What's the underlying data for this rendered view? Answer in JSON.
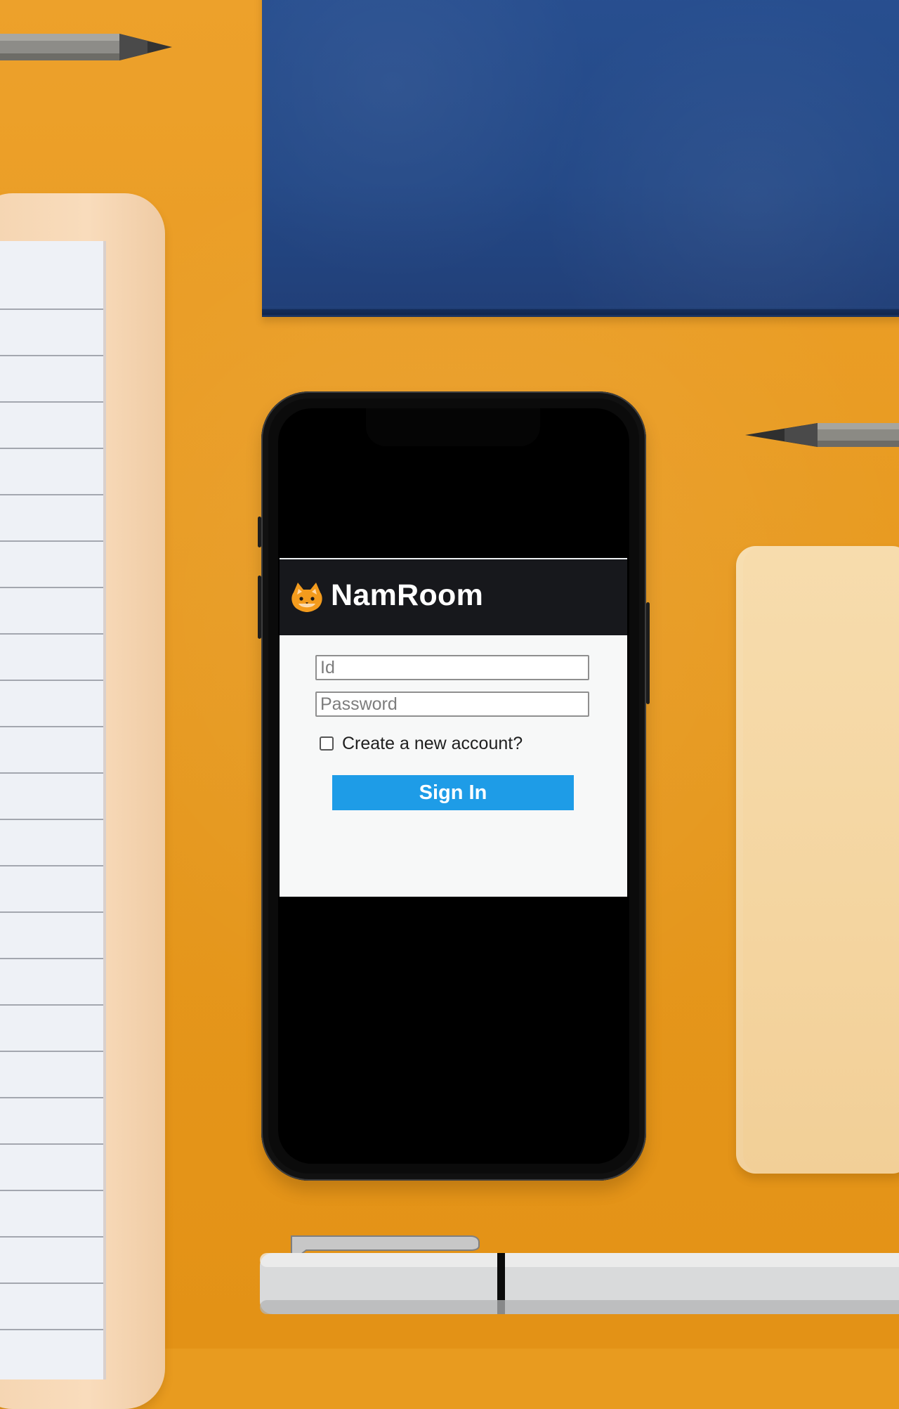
{
  "app": {
    "title": "NamRoom"
  },
  "login_form": {
    "id_placeholder": "Id",
    "password_placeholder": "Password",
    "create_account_label": "Create a new account?",
    "sign_in_label": "Sign In",
    "create_account_checked": false
  },
  "icons": {
    "app_logo": "cat-face-icon"
  },
  "colors": {
    "background": "#e89b1f",
    "header": "#17181c",
    "sign_in_button": "#1e9ce7"
  }
}
